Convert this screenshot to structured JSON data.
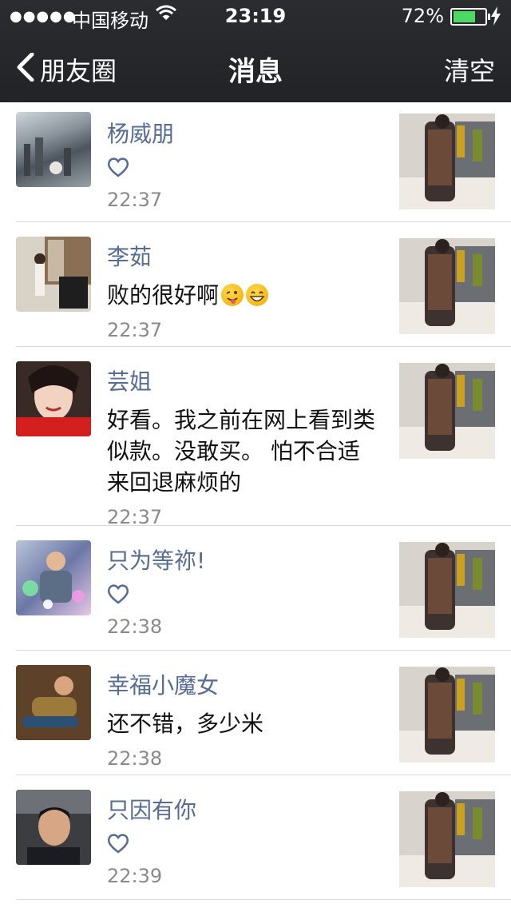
{
  "status_bar": {
    "signal": "●●●●●",
    "carrier": "中国移动",
    "time": "23:19",
    "battery_pct": "72%",
    "battery_level": 0.72,
    "colors": {
      "battery_fill": "#4cd964"
    }
  },
  "nav": {
    "back_label": "朋友圈",
    "title": "消息",
    "clear_label": "清空"
  },
  "colors": {
    "name": "#566b95",
    "time": "#8a8a8a",
    "header_bg": "#232428",
    "divider": "#d9d9d9"
  },
  "messages": [
    {
      "name": "杨威朋",
      "type": "like",
      "comment": "",
      "time": "22:37"
    },
    {
      "name": "李茹",
      "type": "comment",
      "comment": "败的很好啊",
      "emoji": [
        "wink-tongue-emoji",
        "grin-emoji"
      ],
      "time": "22:37"
    },
    {
      "name": "芸姐",
      "type": "comment",
      "comment": "好看。我之前在网上看到类似款。没敢买。 怕不合适来回退麻烦的",
      "time": "22:37"
    },
    {
      "name": "只为等祢!",
      "type": "like",
      "comment": "",
      "time": "22:38"
    },
    {
      "name": "幸福小魔女",
      "type": "comment",
      "comment": "还不错，多少米",
      "time": "22:38"
    },
    {
      "name": "只因有你",
      "type": "like",
      "comment": "",
      "time": "22:39"
    }
  ]
}
